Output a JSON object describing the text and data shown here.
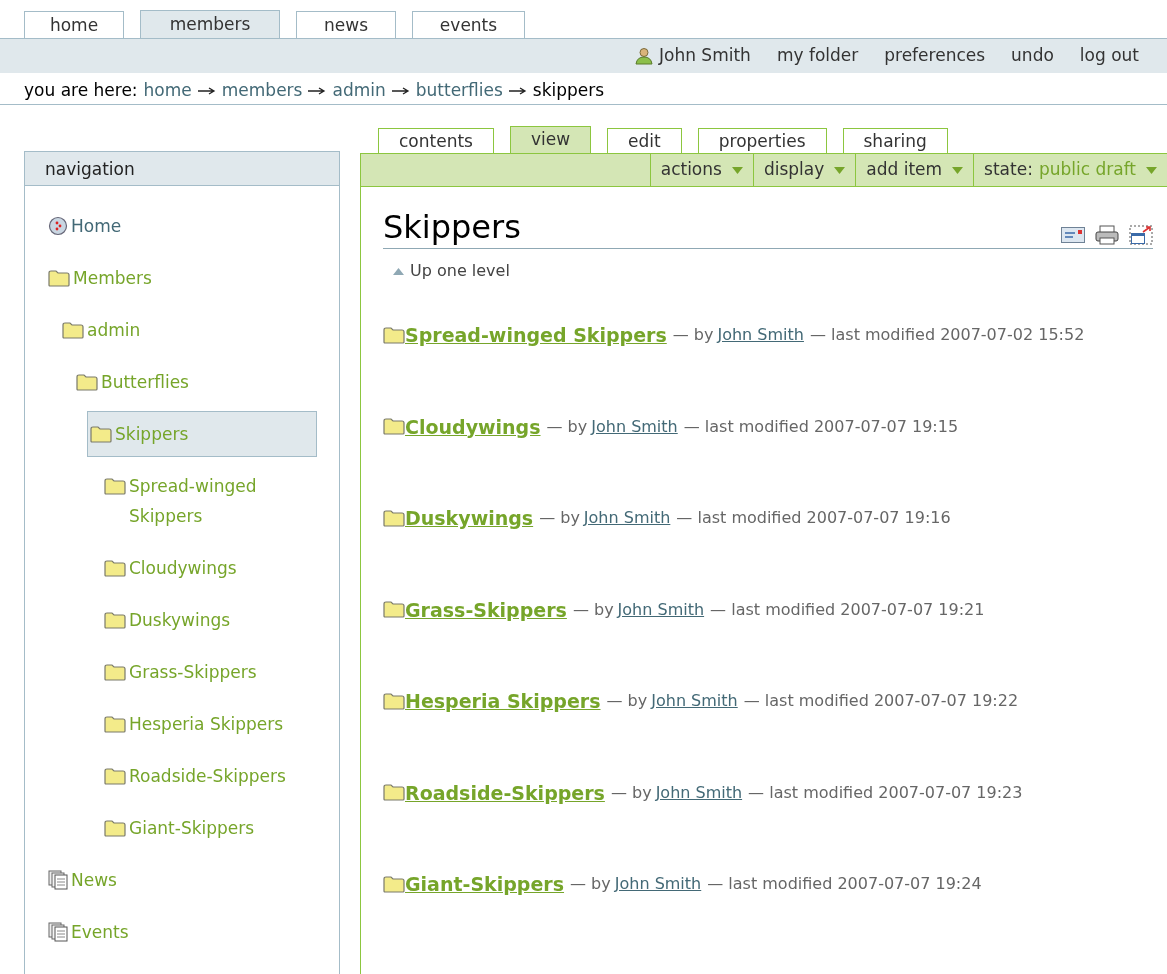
{
  "portal_tabs": [
    {
      "label": "home",
      "selected": false
    },
    {
      "label": "members",
      "selected": true
    },
    {
      "label": "news",
      "selected": false
    },
    {
      "label": "events",
      "selected": false
    }
  ],
  "personal_bar": {
    "user": "John Smith",
    "links": [
      "my folder",
      "preferences",
      "undo",
      "log out"
    ]
  },
  "breadcrumbs": {
    "label": "you are here:",
    "items": [
      {
        "label": "home",
        "current": false
      },
      {
        "label": "members",
        "current": false
      },
      {
        "label": "admin",
        "current": false
      },
      {
        "label": "butterflies",
        "current": false
      },
      {
        "label": "skippers",
        "current": true
      }
    ]
  },
  "navigation": {
    "title": "navigation",
    "tree": [
      {
        "label": "Home",
        "kind": "site",
        "selected": false
      },
      {
        "label": "Members",
        "kind": "folder",
        "selected": false,
        "children": [
          {
            "label": "admin",
            "kind": "folder",
            "selected": false,
            "children": [
              {
                "label": "Butterflies",
                "kind": "folder",
                "selected": false,
                "children": [
                  {
                    "label": "Skippers",
                    "kind": "folder",
                    "selected": true,
                    "children": [
                      {
                        "label": "Spread-winged Skippers",
                        "kind": "folder",
                        "selected": false
                      },
                      {
                        "label": "Cloudywings",
                        "kind": "folder",
                        "selected": false
                      },
                      {
                        "label": "Duskywings",
                        "kind": "folder",
                        "selected": false
                      },
                      {
                        "label": "Grass-Skippers",
                        "kind": "folder",
                        "selected": false
                      },
                      {
                        "label": "Hesperia Skippers",
                        "kind": "folder",
                        "selected": false
                      },
                      {
                        "label": "Roadside-Skippers",
                        "kind": "folder",
                        "selected": false
                      },
                      {
                        "label": "Giant-Skippers",
                        "kind": "folder",
                        "selected": false
                      }
                    ]
                  }
                ]
              }
            ]
          }
        ]
      },
      {
        "label": "News",
        "kind": "collection",
        "selected": false
      },
      {
        "label": "Events",
        "kind": "collection",
        "selected": false
      }
    ]
  },
  "content_tabs": [
    {
      "label": "contents",
      "selected": false
    },
    {
      "label": "view",
      "selected": true
    },
    {
      "label": "edit",
      "selected": false
    },
    {
      "label": "properties",
      "selected": false
    },
    {
      "label": "sharing",
      "selected": false
    }
  ],
  "content_menus": [
    {
      "label": "actions"
    },
    {
      "label": "display"
    },
    {
      "label": "add item"
    },
    {
      "label": "state:",
      "value": "public draft"
    }
  ],
  "document": {
    "title": "Skippers",
    "up_link": "Up one level",
    "listing": [
      {
        "title": "Spread-winged Skippers",
        "by": "— by",
        "author": "John Smith",
        "modified": "— last modified 2007-07-02 15:52"
      },
      {
        "title": "Cloudywings",
        "by": "— by",
        "author": "John Smith",
        "modified": "— last modified 2007-07-07 19:15"
      },
      {
        "title": "Duskywings",
        "by": "— by",
        "author": "John Smith",
        "modified": "— last modified 2007-07-07 19:16"
      },
      {
        "title": "Grass-Skippers",
        "by": "— by",
        "author": "John Smith",
        "modified": "— last modified 2007-07-07 19:21"
      },
      {
        "title": "Hesperia Skippers",
        "by": "— by",
        "author": "John Smith",
        "modified": "— last modified 2007-07-07 19:22"
      },
      {
        "title": "Roadside-Skippers",
        "by": "— by",
        "author": "John Smith",
        "modified": "— last modified 2007-07-07 19:23"
      },
      {
        "title": "Giant-Skippers",
        "by": "— by",
        "author": "John Smith",
        "modified": "— last modified 2007-07-07 19:24"
      }
    ]
  }
}
